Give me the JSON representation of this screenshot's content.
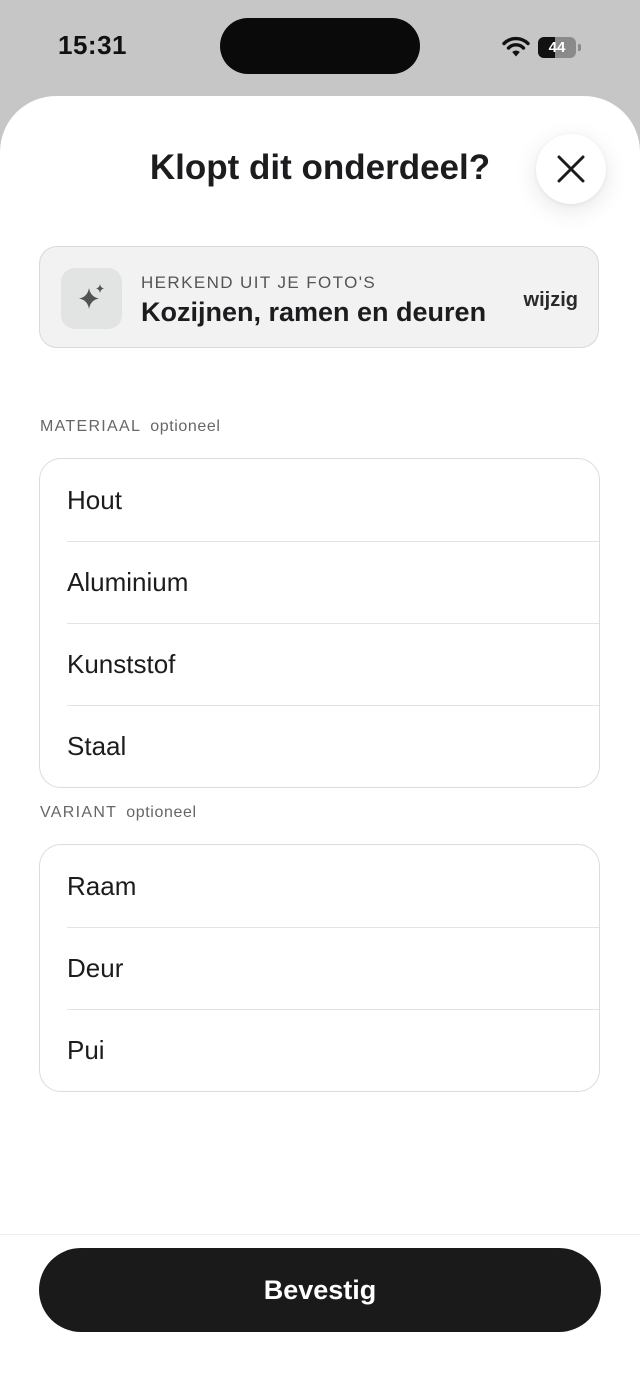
{
  "status_bar": {
    "time": "15:31",
    "battery_level": "44",
    "battery_fraction": 0.44,
    "icons": [
      "wifi-icon",
      "battery-icon"
    ]
  },
  "sheet": {
    "title": "Klopt dit onderdeel?",
    "close_icon": "close-icon"
  },
  "recognized": {
    "icon": "sparkle-icon",
    "label": "HERKEND UIT JE FOTO'S",
    "value": "Kozijnen, ramen en deuren",
    "change_label": "wijzig"
  },
  "material": {
    "label": "MATERIAAL",
    "optional": "optioneel",
    "options": [
      "Hout",
      "Aluminium",
      "Kunststof",
      "Staal"
    ]
  },
  "variant": {
    "label": "VARIANT",
    "optional": "optioneel",
    "options": [
      "Raam",
      "Deur",
      "Pui"
    ]
  },
  "footer": {
    "confirm_label": "Bevestig"
  },
  "colors": {
    "backdrop": "#c6c6c6",
    "sheet": "#ffffff",
    "primary_button": "#1a1a1a",
    "card_background": "#f2f2f3"
  }
}
